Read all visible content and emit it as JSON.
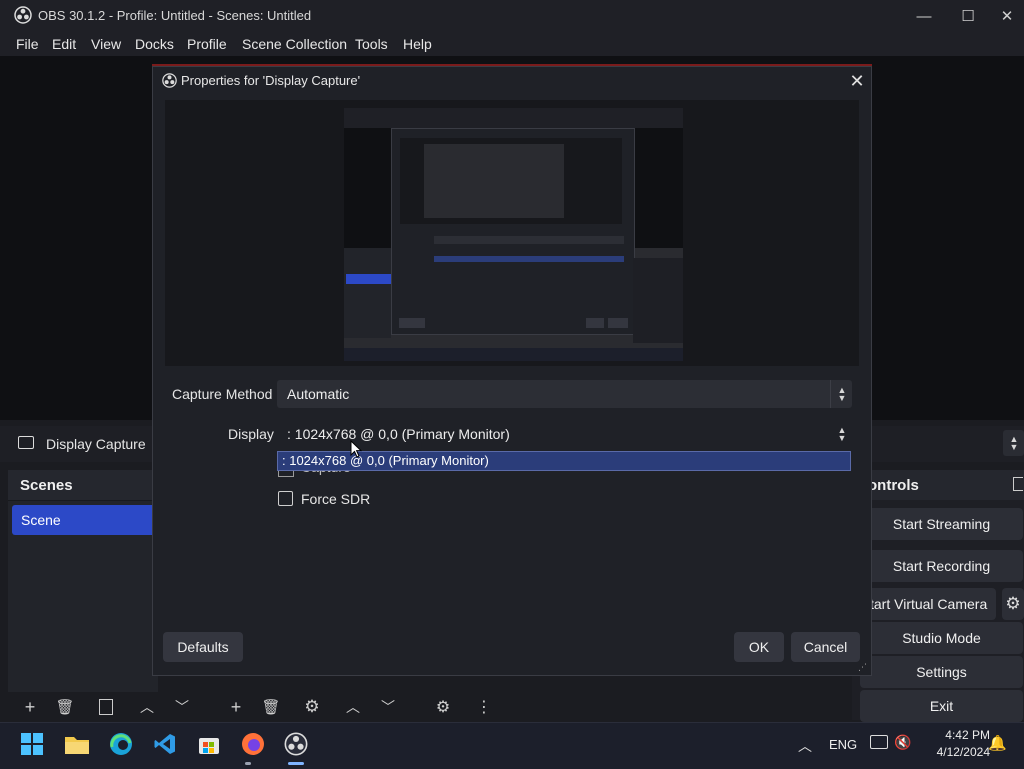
{
  "window": {
    "title": "OBS 30.1.2 - Profile: Untitled - Scenes: Untitled",
    "minimize_glyph": "—",
    "maximize_glyph": "☐",
    "close_glyph": "✕"
  },
  "menu": [
    "File",
    "Edit",
    "View",
    "Docks",
    "Profile",
    "Scene Collection",
    "Tools",
    "Help"
  ],
  "sources": {
    "selected_label": "Display Capture",
    "icon": "monitor-icon"
  },
  "scenes_dock": {
    "title": "Scenes",
    "items": [
      "Scene"
    ]
  },
  "controls_dock": {
    "title": "ontrols",
    "buttons": [
      "Start Streaming",
      "Start Recording",
      "tart Virtual Camera",
      "Studio Mode",
      "Settings",
      "Exit"
    ]
  },
  "dialog": {
    "title": "Properties for 'Display Capture'",
    "close_glyph": "✕",
    "capture_method_label": "Capture Method",
    "capture_method_value": "Automatic",
    "display_label": "Display",
    "display_value": ": 1024x768 @ 0,0 (Primary Monitor)",
    "dropdown_options": [
      ": 1024x768 @ 0,0 (Primary Monitor)"
    ],
    "hidden_checkbox_label": "Capture Cursor",
    "force_sdr_label": "Force SDR",
    "defaults_button": "Defaults",
    "ok_button": "OK",
    "cancel_button": "Cancel"
  },
  "toolbar_icons": [
    "add-icon",
    "trash-icon",
    "filter-icon",
    "up-arrow-icon",
    "down-arrow-icon",
    "add-icon",
    "trash-icon",
    "gear-icon",
    "up-arrow-icon",
    "down-arrow-icon",
    "mixer-gear-icon",
    "more-vertical-icon"
  ],
  "taskbar": {
    "apps": [
      "windows-start-icon",
      "file-explorer-icon",
      "edge-icon",
      "vscode-icon",
      "microsoft-store-icon",
      "firefox-icon",
      "obs-icon"
    ],
    "language": "ENG",
    "time": "4:42 PM",
    "date": "4/12/2024"
  },
  "colors": {
    "accent": "#2c49c7",
    "selection": "#2b3d7a",
    "background": "#1b1c21"
  }
}
